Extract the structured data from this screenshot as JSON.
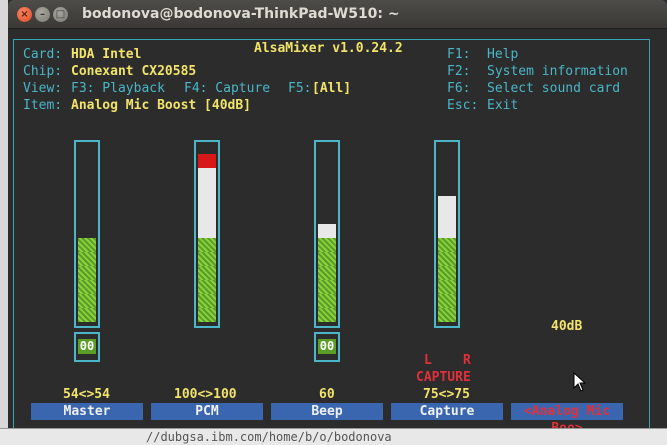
{
  "window": {
    "title": "bodonova@bodonova-ThinkPad-W510: ~"
  },
  "app": {
    "title": "AlsaMixer v1.0.24.2"
  },
  "info": {
    "card_label": "Card:",
    "card_value": "HDA Intel",
    "chip_label": "Chip:",
    "chip_value": "Conexant CX20585",
    "view_label": "View:",
    "view_f3": "F3: Playback",
    "view_f4": "F4: Capture",
    "view_f5": "F5:",
    "view_all": "[All]",
    "item_label": "Item:",
    "item_value": "Analog Mic Boost [40dB]"
  },
  "keys": [
    {
      "key": "F1:",
      "action": "Help"
    },
    {
      "key": "F2:",
      "action": "System information"
    },
    {
      "key": "F6:",
      "action": "Select sound card"
    },
    {
      "key": "Esc:",
      "action": "Exit"
    }
  ],
  "controls": [
    {
      "name": "Master",
      "value": "54<>54",
      "level_green": 6,
      "level_white": 0,
      "level_red": 0,
      "mute": "00"
    },
    {
      "name": "PCM",
      "value": "100<>100",
      "level_green": 6,
      "level_white": 5,
      "level_red": 1,
      "mute": ""
    },
    {
      "name": "Beep",
      "value": "60",
      "level_green": 6,
      "level_white": 1,
      "level_red": 0,
      "mute": "00"
    },
    {
      "name": "Capture",
      "value": "75<>75",
      "level_green": 6,
      "level_white": 3,
      "level_red": 0,
      "mute": ""
    },
    {
      "name": "<Analog Mic Boo>",
      "value": "40dB",
      "level_green": 0,
      "level_white": 0,
      "level_red": 0,
      "mute": ""
    }
  ],
  "capture": {
    "left": "L",
    "right": "R",
    "label": "CAPTURE"
  },
  "background_text": "//dubgsa.ibm.com/home/b/o/bodonova",
  "colors": {
    "cyan": "#4ab6c8",
    "yellow": "#f2e36a",
    "red": "#e0303a",
    "label_bg": "#3a66b0",
    "green": "#8acf3c"
  }
}
